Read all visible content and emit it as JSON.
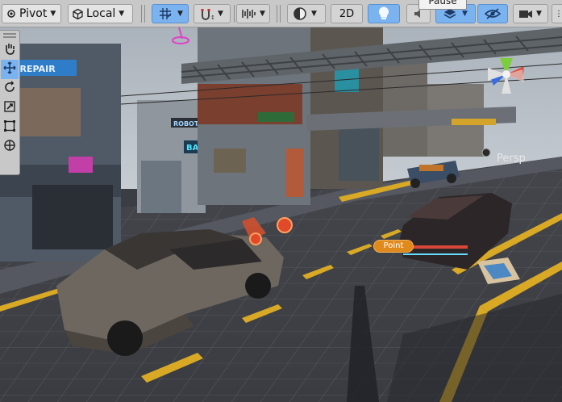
{
  "toolbar": {
    "pivot_label": "Pivot",
    "local_label": "Local",
    "mode_2d_label": "2D",
    "tooltip_text": "Pause"
  },
  "scene": {
    "persp_label": "Persp",
    "point_label": "Point",
    "shop_sign": "NE REPAIR",
    "robotics_sign": "ROBOTICS",
    "bar_sign": "BAR"
  },
  "icons": {
    "pivot": "pivot-icon",
    "local": "cube-local-icon",
    "grid_snap": "grid-snap-icon",
    "snap_increment": "snap-increment-icon",
    "audio": "audio-bars-icon",
    "shading": "shading-sphere-icon",
    "lighting": "light-bulb-icon",
    "effects": "layers-icon",
    "visibility": "hidden-eye-icon",
    "camera": "camera-icon",
    "hand": "hand-tool-icon",
    "move": "move-tool-icon",
    "rotate": "rotate-tool-icon",
    "scale": "scale-tool-icon",
    "rect": "rect-tool-icon",
    "transform": "transform-tool-icon"
  },
  "colors": {
    "toolbar_bg": "#c8c8c8",
    "active_blue": "#7ab3f0",
    "road": "#3e4046",
    "road_line": "#d9a926",
    "sky": "#b9c0c8",
    "point_orange": "#e08a1e"
  }
}
